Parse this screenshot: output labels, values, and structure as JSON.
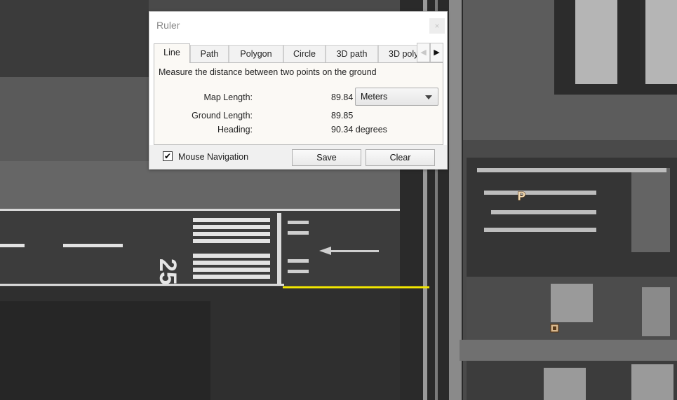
{
  "window": {
    "title": "Ruler",
    "close_glyph": "×"
  },
  "tabs": [
    {
      "label": "Line",
      "active": true
    },
    {
      "label": "Path",
      "active": false
    },
    {
      "label": "Polygon",
      "active": false
    },
    {
      "label": "Circle",
      "active": false
    },
    {
      "label": "3D path",
      "active": false
    },
    {
      "label": "3D poly",
      "active": false
    }
  ],
  "tab_scroll": {
    "left_glyph": "◀",
    "right_glyph": "▶"
  },
  "panel": {
    "description": "Measure the distance between two points on the ground",
    "map_length_label": "Map Length:",
    "map_length_value": "89.84",
    "unit_selected": "Meters",
    "ground_length_label": "Ground Length:",
    "ground_length_value": "89.85",
    "heading_label": "Heading:",
    "heading_value": "90.34 degrees"
  },
  "footer": {
    "mouse_nav_label": "Mouse Navigation",
    "mouse_nav_checked": true,
    "check_glyph": "✔",
    "save_label": "Save",
    "clear_label": "Clear"
  },
  "map": {
    "runway_number": "25",
    "parking_marker": "P",
    "measure_line_color": "#f2e600",
    "icons": [
      "parking-icon",
      "placemark-square-icon"
    ]
  }
}
